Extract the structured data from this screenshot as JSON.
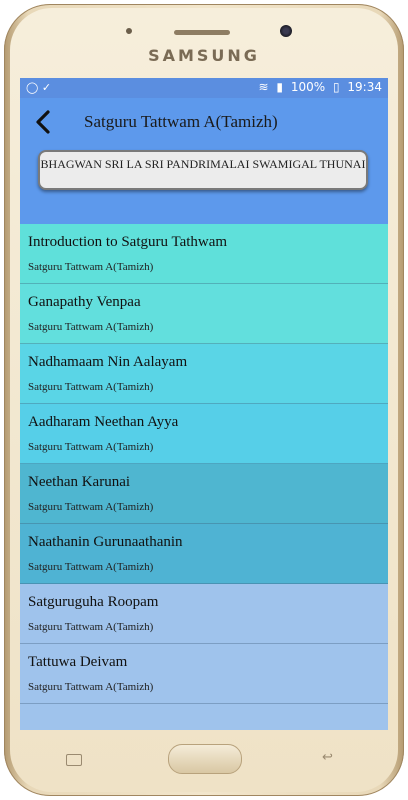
{
  "device": {
    "brand": "SAMSUNG"
  },
  "statusbar": {
    "battery": "100%",
    "time": "19:34"
  },
  "header": {
    "title": "Satguru Tattwam A(Tamizh)",
    "banner": "BHAGWAN SRI LA SRI PANDRIMALAI SWAMIGAL THUNAI"
  },
  "colors": {
    "statusbar": "#5b8ee0",
    "header": "#5d99ec",
    "screen_bg": "#9fc3ec",
    "row_colors": [
      "#5fe0da",
      "#62dfdd",
      "#5ad5e6",
      "#56cfe8",
      "#4fb6d0",
      "#4fb3d3",
      "#9fc3ec",
      "#9fc3ec"
    ]
  },
  "list": [
    {
      "title": "Introduction to Satguru Tathwam",
      "subtitle": "Satguru Tattwam A(Tamizh)"
    },
    {
      "title": "Ganapathy Venpaa",
      "subtitle": "Satguru Tattwam A(Tamizh)"
    },
    {
      "title": "Nadhamaam Nin Aalayam",
      "subtitle": "Satguru Tattwam A(Tamizh)"
    },
    {
      "title": "Aadharam Neethan Ayya",
      "subtitle": "Satguru Tattwam A(Tamizh)"
    },
    {
      "title": " Neethan Karunai",
      "subtitle": "Satguru Tattwam A(Tamizh)"
    },
    {
      "title": "Naathanin Gurunaathanin",
      "subtitle": "Satguru Tattwam A(Tamizh)"
    },
    {
      "title": "Satguruguha Roopam",
      "subtitle": "Satguru Tattwam A(Tamizh)"
    },
    {
      "title": "Tattuwa Deivam",
      "subtitle": "Satguru Tattwam A(Tamizh)"
    }
  ]
}
